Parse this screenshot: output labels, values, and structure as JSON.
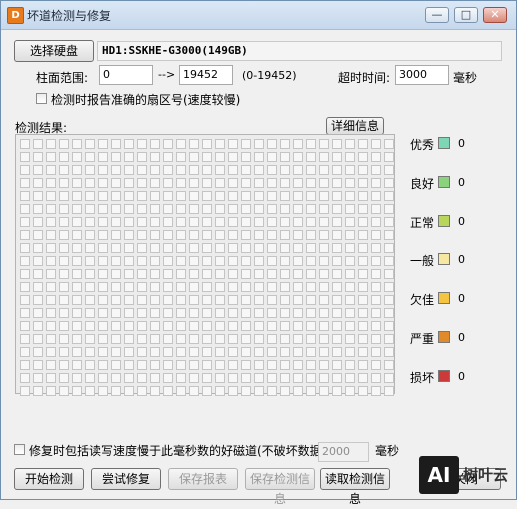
{
  "window": {
    "title": "坏道检测与修复",
    "app_icon": "bd-app-icon",
    "controls": {
      "minimize": "—",
      "maximize": "□",
      "close": "✕"
    }
  },
  "disk": {
    "select_button": "选择硬盘",
    "info": "HD1:SSKHE-G3000(149GB)"
  },
  "range": {
    "label": "柱面范围:",
    "start": "0",
    "arrow": "-->",
    "end": "19452",
    "hint": "(0-19452)"
  },
  "timeout": {
    "label": "超时时间:",
    "value": "3000",
    "unit": "毫秒"
  },
  "report_sector": {
    "label": "检测时报告准确的扇区号(速度较慢)",
    "checked": false
  },
  "results": {
    "label": "检测结果:",
    "details_button": "详细信息"
  },
  "legend": [
    {
      "label": "优秀",
      "color": "#7fd6b4",
      "count": "0"
    },
    {
      "label": "良好",
      "color": "#8ad27c",
      "count": "0"
    },
    {
      "label": "正常",
      "color": "#b8d65c",
      "count": "0"
    },
    {
      "label": "一般",
      "color": "#f7e7a0",
      "count": "0"
    },
    {
      "label": "欠佳",
      "color": "#f5c542",
      "count": "0"
    },
    {
      "label": "严重",
      "color": "#e08a2c",
      "count": "0"
    },
    {
      "label": "损坏",
      "color": "#cc3a3a",
      "count": "0"
    }
  ],
  "repair_option": {
    "label": "修复时包括读写速度慢于此毫秒数的好磁道(不破坏数据):",
    "value": "2000",
    "unit": "毫秒",
    "checked": false
  },
  "buttons": {
    "start": "开始检测",
    "try_repair": "尝试修复",
    "save_report": "保存报表",
    "save_info": "保存检测信息",
    "read_info": "读取检测信息",
    "close": "关闭"
  },
  "watermark": {
    "logo": "AI",
    "text": "树叶云"
  }
}
